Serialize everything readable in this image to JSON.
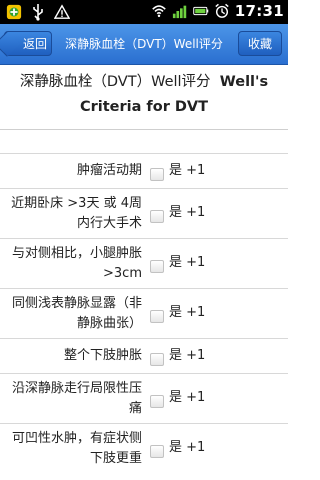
{
  "status_bar": {
    "time": "17:31",
    "icons": [
      "app-notification-icon",
      "usb-icon",
      "warning-icon",
      "wifi-icon",
      "signal-icon",
      "battery-icon",
      "alarm-icon"
    ]
  },
  "title_bar": {
    "back_label": "返回",
    "title": "深静脉血栓（DVT）Well评分",
    "favorite_label": "收藏"
  },
  "heading": {
    "line1": "深静脉血栓（DVT）Well评分",
    "line1_en": "Well's",
    "line2": "Criteria for DVT"
  },
  "criteria": [
    {
      "label": "肿瘤活动期",
      "option": "是 +1"
    },
    {
      "label": "近期卧床 >3天 或 4周内行大手术",
      "option": "是 +1"
    },
    {
      "label": "与对侧相比，小腿肿胀 >3cm",
      "option": "是 +1"
    },
    {
      "label": "同侧浅表静脉显露（非静脉曲张）",
      "option": "是 +1"
    },
    {
      "label": "整个下肢肿胀",
      "option": "是 +1"
    },
    {
      "label": "沿深静脉走行局限性压痛",
      "option": "是 +1"
    },
    {
      "label": "可凹性水肿，有症状侧下肢更重",
      "option": "是 +1"
    }
  ]
}
